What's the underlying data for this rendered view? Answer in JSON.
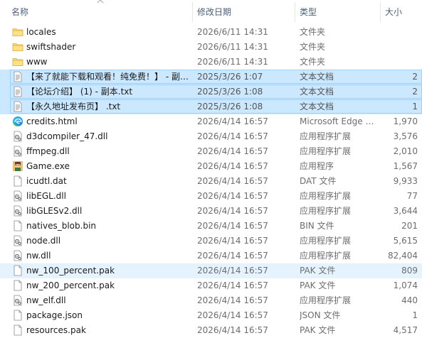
{
  "columns": {
    "name": "名称",
    "date": "修改日期",
    "type": "类型",
    "size": "大小"
  },
  "files": [
    {
      "name": "locales",
      "date": "2026/6/11 14:31",
      "type": "文件夹",
      "size": "",
      "icon": "folder-icon",
      "state": ""
    },
    {
      "name": "swiftshader",
      "date": "2026/6/11 14:31",
      "type": "文件夹",
      "size": "",
      "icon": "folder-icon",
      "state": ""
    },
    {
      "name": "www",
      "date": "2026/6/11 14:31",
      "type": "文件夹",
      "size": "",
      "icon": "folder-icon",
      "state": ""
    },
    {
      "name": "【来了就能下载和观看！纯免费！】 - 副…",
      "date": "2025/3/26 1:07",
      "type": "文本文档",
      "size": "2",
      "icon": "text-file-icon",
      "state": "sel"
    },
    {
      "name": "【论坛介绍】 (1) - 副本.txt",
      "date": "2025/3/26 1:08",
      "type": "文本文档",
      "size": "2",
      "icon": "text-file-icon",
      "state": "sel"
    },
    {
      "name": "【永久地址发布页】 .txt",
      "date": "2025/3/26 1:08",
      "type": "文本文档",
      "size": "1",
      "icon": "text-file-icon",
      "state": "sel"
    },
    {
      "name": "credits.html",
      "date": "2026/4/14 16:57",
      "type": "Microsoft Edge …",
      "size": "1,970",
      "icon": "edge-icon",
      "state": ""
    },
    {
      "name": "d3dcompiler_47.dll",
      "date": "2026/4/14 16:57",
      "type": "应用程序扩展",
      "size": "3,576",
      "icon": "dll-icon",
      "state": ""
    },
    {
      "name": "ffmpeg.dll",
      "date": "2026/4/14 16:57",
      "type": "应用程序扩展",
      "size": "2,010",
      "icon": "dll-icon",
      "state": ""
    },
    {
      "name": "Game.exe",
      "date": "2026/4/14 16:57",
      "type": "应用程序",
      "size": "1,567",
      "icon": "game-exe-icon",
      "state": ""
    },
    {
      "name": "icudtl.dat",
      "date": "2026/4/14 16:57",
      "type": "DAT 文件",
      "size": "9,933",
      "icon": "file-icon",
      "state": ""
    },
    {
      "name": "libEGL.dll",
      "date": "2026/4/14 16:57",
      "type": "应用程序扩展",
      "size": "77",
      "icon": "dll-icon",
      "state": ""
    },
    {
      "name": "libGLESv2.dll",
      "date": "2026/4/14 16:57",
      "type": "应用程序扩展",
      "size": "3,644",
      "icon": "dll-icon",
      "state": ""
    },
    {
      "name": "natives_blob.bin",
      "date": "2026/4/14 16:57",
      "type": "BIN 文件",
      "size": "201",
      "icon": "file-icon",
      "state": ""
    },
    {
      "name": "node.dll",
      "date": "2026/4/14 16:57",
      "type": "应用程序扩展",
      "size": "5,615",
      "icon": "dll-icon",
      "state": ""
    },
    {
      "name": "nw.dll",
      "date": "2026/4/14 16:57",
      "type": "应用程序扩展",
      "size": "82,404",
      "icon": "dll-icon",
      "state": ""
    },
    {
      "name": "nw_100_percent.pak",
      "date": "2026/4/14 16:57",
      "type": "PAK 文件",
      "size": "809",
      "icon": "file-icon",
      "state": "hov"
    },
    {
      "name": "nw_200_percent.pak",
      "date": "2026/4/14 16:57",
      "type": "PAK 文件",
      "size": "1,074",
      "icon": "file-icon",
      "state": ""
    },
    {
      "name": "nw_elf.dll",
      "date": "2026/4/14 16:57",
      "type": "应用程序扩展",
      "size": "440",
      "icon": "dll-icon",
      "state": ""
    },
    {
      "name": "package.json",
      "date": "2026/4/14 16:57",
      "type": "JSON 文件",
      "size": "1",
      "icon": "file-icon",
      "state": ""
    },
    {
      "name": "resources.pak",
      "date": "2026/4/14 16:57",
      "type": "PAK 文件",
      "size": "4,517",
      "icon": "file-icon",
      "state": ""
    }
  ]
}
